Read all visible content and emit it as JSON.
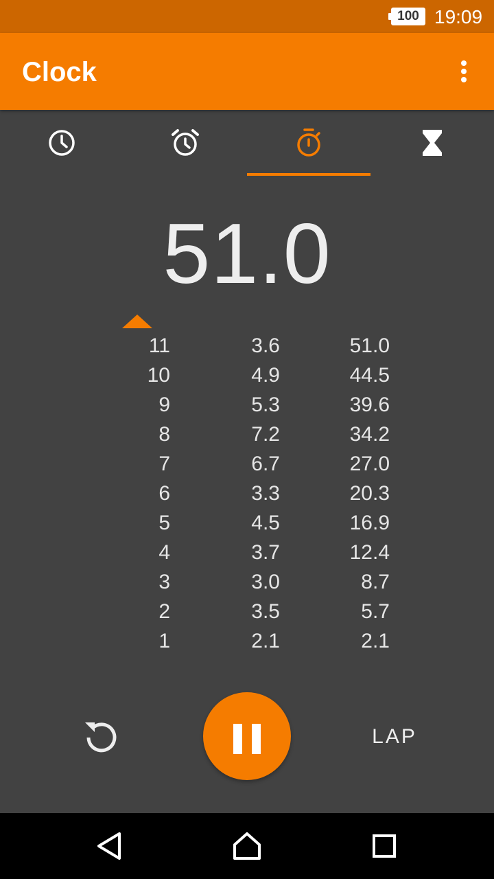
{
  "status_bar": {
    "battery": "100",
    "time": "19:09",
    "color": "#cc6600"
  },
  "app_bar": {
    "title": "Clock",
    "color": "#f57c00",
    "menu_icon": "overflow-menu-icon"
  },
  "tabs": [
    {
      "icon": "clock-icon",
      "selected": false
    },
    {
      "icon": "alarm-icon",
      "selected": false
    },
    {
      "icon": "stopwatch-icon",
      "selected": true
    },
    {
      "icon": "timer-hourglass-icon",
      "selected": false
    }
  ],
  "stopwatch": {
    "elapsed": "51.0",
    "laps": [
      {
        "num": "11",
        "split": "3.6",
        "total": "51.0"
      },
      {
        "num": "10",
        "split": "4.9",
        "total": "44.5"
      },
      {
        "num": "9",
        "split": "5.3",
        "total": "39.6"
      },
      {
        "num": "8",
        "split": "7.2",
        "total": "34.2"
      },
      {
        "num": "7",
        "split": "6.7",
        "total": "27.0"
      },
      {
        "num": "6",
        "split": "3.3",
        "total": "20.3"
      },
      {
        "num": "5",
        "split": "4.5",
        "total": "16.9"
      },
      {
        "num": "4",
        "split": "3.7",
        "total": "12.4"
      },
      {
        "num": "3",
        "split": "3.0",
        "total": "8.7"
      },
      {
        "num": "2",
        "split": "3.5",
        "total": "5.7"
      },
      {
        "num": "1",
        "split": "2.1",
        "total": "2.1"
      }
    ]
  },
  "controls": {
    "reset_icon": "reset-icon",
    "pause_icon": "pause-icon",
    "lap_label": "LAP"
  },
  "nav": {
    "back_icon": "back-icon",
    "home_icon": "home-icon",
    "recents_icon": "recents-icon"
  }
}
